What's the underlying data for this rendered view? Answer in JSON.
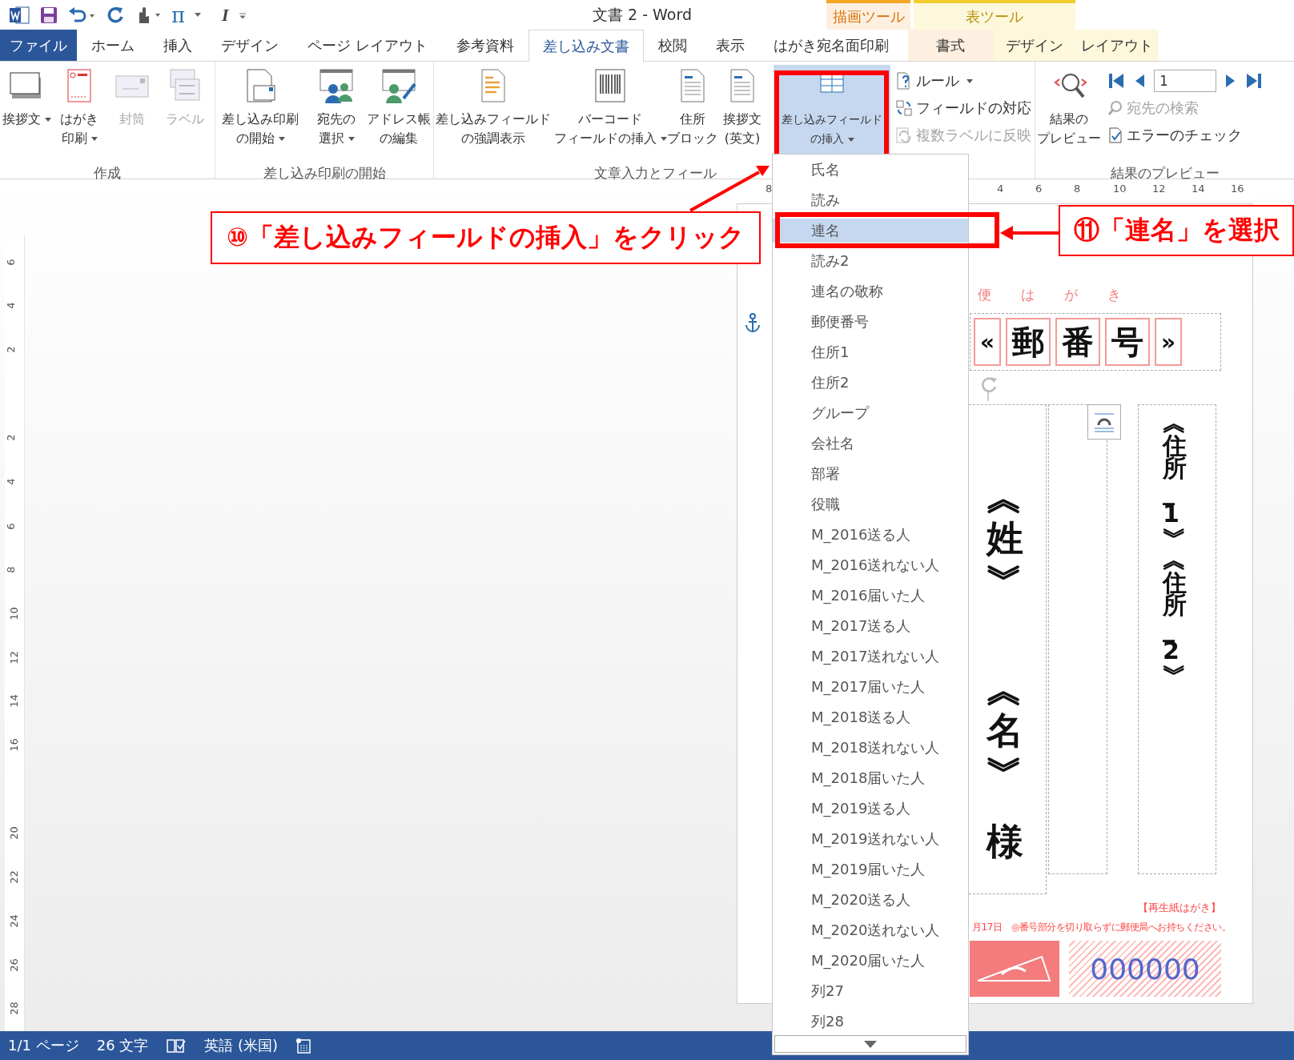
{
  "title_bar": {
    "quick_access": {
      "pi": "π",
      "italic": "I"
    },
    "title": "文書 2 - Word",
    "context_groups": [
      {
        "label": "描画ツール",
        "kind": "drawing"
      },
      {
        "label": "表ツール",
        "kind": "table"
      }
    ]
  },
  "tabs": [
    {
      "label": "ファイル",
      "kind": "file",
      "selected": false
    },
    {
      "label": "ホーム",
      "kind": "tab",
      "selected": false
    },
    {
      "label": "挿入",
      "kind": "tab",
      "selected": false
    },
    {
      "label": "デザイン",
      "kind": "tab",
      "selected": false
    },
    {
      "label": "ページ レイアウト",
      "kind": "tab",
      "selected": false
    },
    {
      "label": "参考資料",
      "kind": "tab",
      "selected": false
    },
    {
      "label": "差し込み文書",
      "kind": "tab",
      "selected": true
    },
    {
      "label": "校閲",
      "kind": "tab",
      "selected": false
    },
    {
      "label": "表示",
      "kind": "tab",
      "selected": false
    },
    {
      "label": "はがき宛名面印刷",
      "kind": "tab",
      "selected": false
    },
    {
      "label": "書式",
      "kind": "drawing",
      "selected": false
    },
    {
      "label": "デザイン",
      "kind": "table",
      "selected": false
    },
    {
      "label": "レイアウト",
      "kind": "table",
      "selected": false
    }
  ],
  "ribbon": {
    "groups": [
      {
        "label": "作成",
        "buttons": [
          {
            "kind": "greeting",
            "lines": [
              "挨拶文"
            ],
            "menu": true,
            "disabled": false,
            "selected": false
          },
          {
            "kind": "postcard",
            "lines": [
              "はがき",
              "印刷"
            ],
            "menu": true,
            "disabled": false,
            "selected": false
          },
          {
            "kind": "envelope",
            "lines": [
              "封筒"
            ],
            "menu": false,
            "disabled": true,
            "selected": false
          },
          {
            "kind": "label",
            "lines": [
              "ラベル"
            ],
            "menu": false,
            "disabled": true,
            "selected": false
          }
        ]
      },
      {
        "label": "差し込み印刷の開始",
        "buttons": [
          {
            "kind": "merge",
            "lines": [
              "差し込み印刷",
              "の開始"
            ],
            "menu": true,
            "disabled": false,
            "selected": false
          },
          {
            "kind": "recipients",
            "lines": [
              "宛先の",
              "選択"
            ],
            "menu": true,
            "disabled": false,
            "selected": false
          },
          {
            "kind": "addressbook",
            "lines": [
              "アドレス帳",
              "の編集"
            ],
            "menu": false,
            "disabled": false,
            "selected": false
          }
        ]
      },
      {
        "label": "文章入力とフィール",
        "buttons": [
          {
            "kind": "highlight",
            "lines": [
              "差し込みフィールド",
              "の強調表示"
            ],
            "menu": false,
            "disabled": false,
            "selected": false
          },
          {
            "kind": "barcode",
            "lines": [
              "バーコード",
              "フィールドの挿入"
            ],
            "menu": true,
            "disabled": false,
            "selected": false
          },
          {
            "kind": "doc",
            "lines": [
              "住所",
              "ブロック"
            ],
            "menu": false,
            "disabled": false,
            "selected": false
          },
          {
            "kind": "doc",
            "lines": [
              "挨拶文",
              "(英文)"
            ],
            "menu": false,
            "disabled": false,
            "selected": false
          },
          {
            "kind": "insert",
            "lines": [
              "差し込みフィールド",
              "の挿入"
            ],
            "menu": true,
            "disabled": false,
            "selected": true
          }
        ],
        "small": [
          {
            "kind": "rule",
            "label": "ルール",
            "menu": true,
            "disabled": false
          },
          {
            "kind": "match",
            "label": "フィールドの対応",
            "menu": false,
            "disabled": false
          },
          {
            "kind": "update",
            "label": "複数ラベルに反映",
            "menu": false,
            "disabled": true
          }
        ]
      },
      {
        "label": "結果のプレビュー",
        "buttons": [
          {
            "kind": "preview",
            "lines": [
              "結果の",
              "プレビュー"
            ],
            "menu": false,
            "disabled": false,
            "selected": false
          }
        ],
        "record": {
          "value": "1"
        },
        "small": [
          {
            "kind": "find",
            "label": "宛先の検索",
            "menu": false,
            "disabled": true
          },
          {
            "kind": "check",
            "label": "エラーのチェック",
            "menu": false,
            "disabled": false
          }
        ]
      }
    ]
  },
  "ruler": {
    "horizontal": [
      "8",
      "4",
      "6",
      "8",
      "10",
      "12",
      "14",
      "16"
    ],
    "vertical": [
      "6",
      "4",
      "2",
      "2",
      "4",
      "6",
      "8",
      "10",
      "12",
      "14",
      "16",
      "20",
      "22",
      "24",
      "26",
      "28"
    ]
  },
  "postcard": {
    "header": "便　は　が　き",
    "postal": [
      "«",
      "郵",
      "番",
      "号",
      "»"
    ],
    "family_name": "︽姓︾",
    "given_name": "︽名︾",
    "honorific": "様",
    "address": "︽住所_1︾︽住所_2︾",
    "recycled_note": "【再生紙はがき】",
    "notice": "月17日　◎番号部分を切り取らずに郵便局へお持ちください。",
    "lottery_number": "000000"
  },
  "field_menu": {
    "items": [
      {
        "label": "氏名",
        "selected": false
      },
      {
        "label": "読み",
        "selected": false
      },
      {
        "label": "連名",
        "selected": true
      },
      {
        "label": "読み2",
        "selected": false
      },
      {
        "label": "連名の敬称",
        "selected": false
      },
      {
        "label": "郵便番号",
        "selected": false
      },
      {
        "label": "住所1",
        "selected": false
      },
      {
        "label": "住所2",
        "selected": false
      },
      {
        "label": "グループ",
        "selected": false
      },
      {
        "label": "会社名",
        "selected": false
      },
      {
        "label": "部署",
        "selected": false
      },
      {
        "label": "役職",
        "selected": false
      },
      {
        "label": "M_2016送る人",
        "selected": false
      },
      {
        "label": "M_2016送れない人",
        "selected": false
      },
      {
        "label": "M_2016届いた人",
        "selected": false
      },
      {
        "label": "M_2017送る人",
        "selected": false
      },
      {
        "label": "M_2017送れない人",
        "selected": false
      },
      {
        "label": "M_2017届いた人",
        "selected": false
      },
      {
        "label": "M_2018送る人",
        "selected": false
      },
      {
        "label": "M_2018送れない人",
        "selected": false
      },
      {
        "label": "M_2018届いた人",
        "selected": false
      },
      {
        "label": "M_2019送る人",
        "selected": false
      },
      {
        "label": "M_2019送れない人",
        "selected": false
      },
      {
        "label": "M_2019届いた人",
        "selected": false
      },
      {
        "label": "M_2020送る人",
        "selected": false
      },
      {
        "label": "M_2020送れない人",
        "selected": false
      },
      {
        "label": "M_2020届いた人",
        "selected": false
      },
      {
        "label": "列27",
        "selected": false
      },
      {
        "label": "列28",
        "selected": false
      }
    ]
  },
  "annotations": [
    {
      "text": "⑩「差し込みフィールドの挿入」をクリック"
    },
    {
      "text": "⑪「連名」を選択"
    }
  ],
  "status_bar": {
    "page": "1/1 ページ",
    "words": "26 文字",
    "language": "英語 (米国)"
  }
}
